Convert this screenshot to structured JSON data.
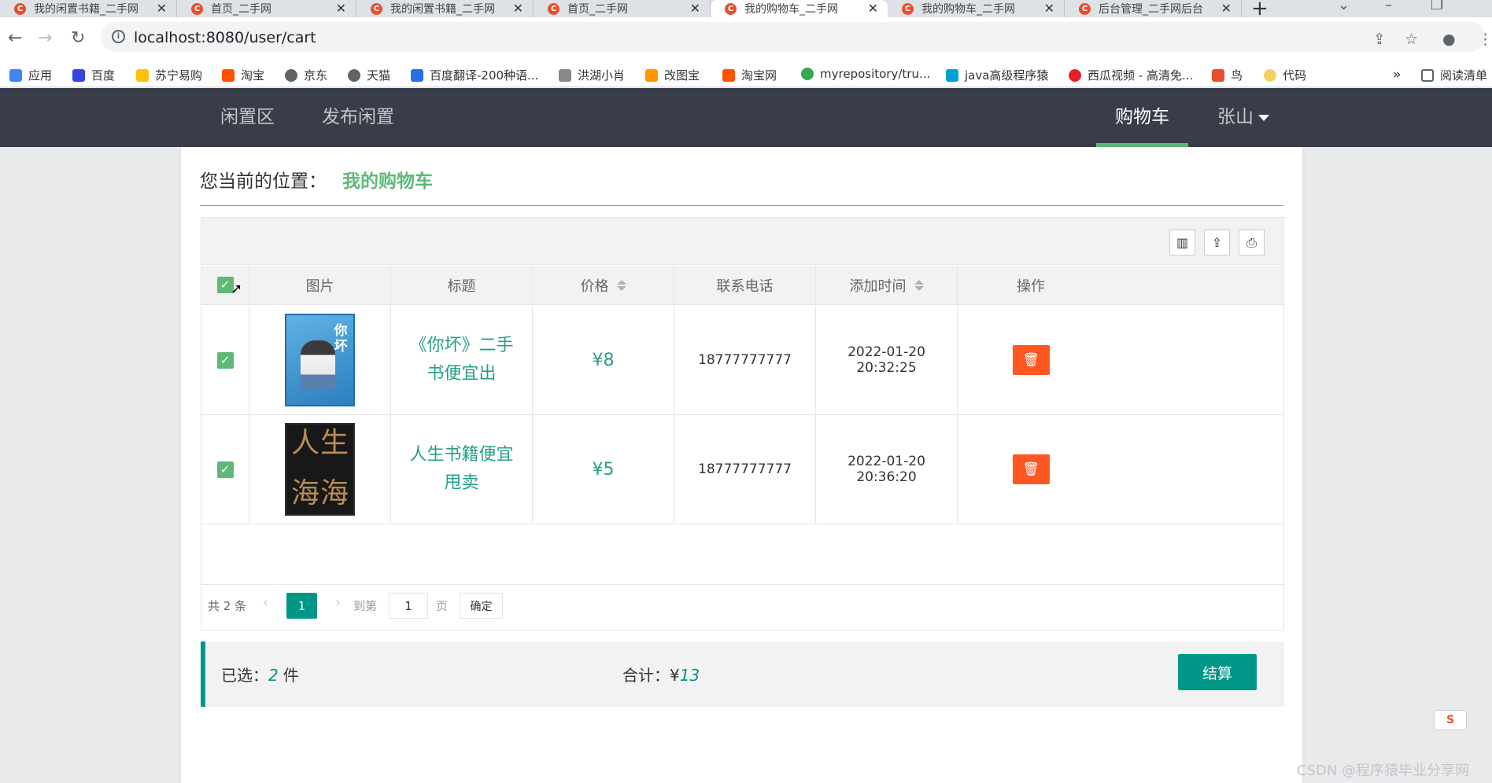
{
  "browser": {
    "tabs": [
      {
        "title": "我的闲置书籍_二手网",
        "icon": "C"
      },
      {
        "title": "首页_二手网",
        "icon": "C"
      },
      {
        "title": "我的闲置书籍_二手网",
        "icon": "C"
      },
      {
        "title": "首页_二手网",
        "icon": "C"
      },
      {
        "title": "我的购物车_二手网",
        "icon": "C",
        "active": true
      },
      {
        "title": "我的购物车_二手网",
        "icon": "C"
      },
      {
        "title": "后台管理_二手网后台",
        "icon": "C"
      }
    ],
    "close_glyph": "✕",
    "new_tab": "+",
    "url": "localhost:8080/user/cart",
    "bookmarks": [
      {
        "label": "应用",
        "color": "#4285f4"
      },
      {
        "label": "百度",
        "color": "#3245df"
      },
      {
        "label": "苏宁易购",
        "color": "#ffc107"
      },
      {
        "label": "淘宝",
        "color": "#ff5000"
      },
      {
        "label": "京东",
        "color": "#5f6368"
      },
      {
        "label": "天猫",
        "color": "#5f6368"
      },
      {
        "label": "百度翻译-200种语...",
        "color": "#2b6de5"
      },
      {
        "label": "洪湖小肖",
        "color": "#888888"
      },
      {
        "label": "改图宝",
        "color": "#ff9800"
      },
      {
        "label": "淘宝网",
        "color": "#ff5000"
      },
      {
        "label": "myrepository/tru...",
        "color": "#34a853"
      },
      {
        "label": "java高级程序猿",
        "color": "#00a1d6"
      },
      {
        "label": "西瓜视频 - 高清免...",
        "color": "#e5202e"
      },
      {
        "label": "鸟",
        "color": "#e94e2e"
      },
      {
        "label": "代码",
        "color": "#f4d35e"
      }
    ],
    "bookmarks_more": "»",
    "reading_list": "阅读清单"
  },
  "nav": {
    "left": [
      "闲置区",
      "发布闲置"
    ],
    "cart": "购物车",
    "user": "张山"
  },
  "page": {
    "crumb_label": "您当前的位置：",
    "crumb_here": "我的购物车"
  },
  "table": {
    "headers": [
      "图片",
      "标题",
      "价格",
      "联系电话",
      "添加时间",
      "操作"
    ],
    "rows": [
      {
        "title": "《你坏》二手书便宜出",
        "price": "¥8",
        "phone": "18777777777",
        "time": "2022-01-20 20:32:25",
        "cover": [
          "你",
          "坏"
        ]
      },
      {
        "title": "人生书籍便宜甩卖",
        "price": "¥5",
        "phone": "18777777777",
        "time": "2022-01-20 20:36:20",
        "cover": [
          "人",
          "生",
          "海",
          "海"
        ]
      }
    ]
  },
  "pager": {
    "total": "共 2 条",
    "current": "1",
    "goto": "到第",
    "input": "1",
    "page_unit": "页",
    "confirm": "确定"
  },
  "summary": {
    "selected_label": "已选：",
    "selected_count": "2",
    "selected_unit": "件",
    "total_label": "合计：¥",
    "total_value": "13",
    "checkout": "结算"
  },
  "watermark": "CSDN @程序猿毕业分享网",
  "csdn_badge": "S",
  "colors": {
    "accent": "#009688",
    "green": "#5fb878",
    "danger": "#ff5722",
    "nav": "#393d49"
  }
}
